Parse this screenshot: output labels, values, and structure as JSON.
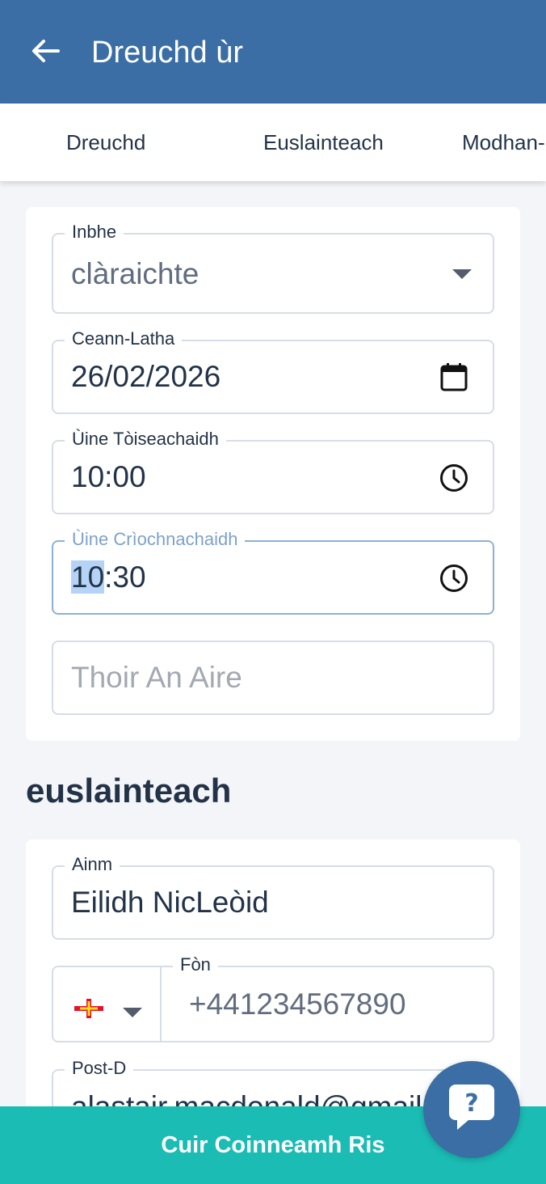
{
  "header": {
    "title": "Dreuchd ùr",
    "back_icon": "arrow-left-icon"
  },
  "tabs": [
    {
      "label": "Dreuchd"
    },
    {
      "label": "Euslainteach"
    },
    {
      "label": "Modhan-"
    }
  ],
  "appointment": {
    "status": {
      "label": "Inbhe",
      "value": "clàraichte"
    },
    "date": {
      "label": "Ceann-Latha",
      "value": "26/02/2026",
      "icon": "calendar-icon"
    },
    "start_time": {
      "label": "Ùine Tòiseachaidh",
      "value": "10:00",
      "icon": "clock-icon"
    },
    "end_time": {
      "label": "Ùine Crìochnachaidh",
      "value_selected": "10",
      "value_rest": ":30",
      "icon": "clock-icon"
    },
    "notes": {
      "placeholder": "Thoir An Aire"
    }
  },
  "patient": {
    "section_title": "euslainteach",
    "name": {
      "label": "Ainm",
      "value": "Eilidh NicLeòid"
    },
    "phone": {
      "label": "Fòn",
      "value": "+441234567890",
      "country_flag": "guernsey-flag-icon"
    },
    "email": {
      "label": "Post-D",
      "value": "alastair.macdonald@gmail.com"
    }
  },
  "actions": {
    "submit_label": "Cuir Coinneamh Ris",
    "help_icon": "help-chat-icon"
  },
  "colors": {
    "header": "#3a6ea5",
    "accent": "#1abcb4",
    "text": "#233347",
    "focus_label": "#7ea1c9"
  }
}
